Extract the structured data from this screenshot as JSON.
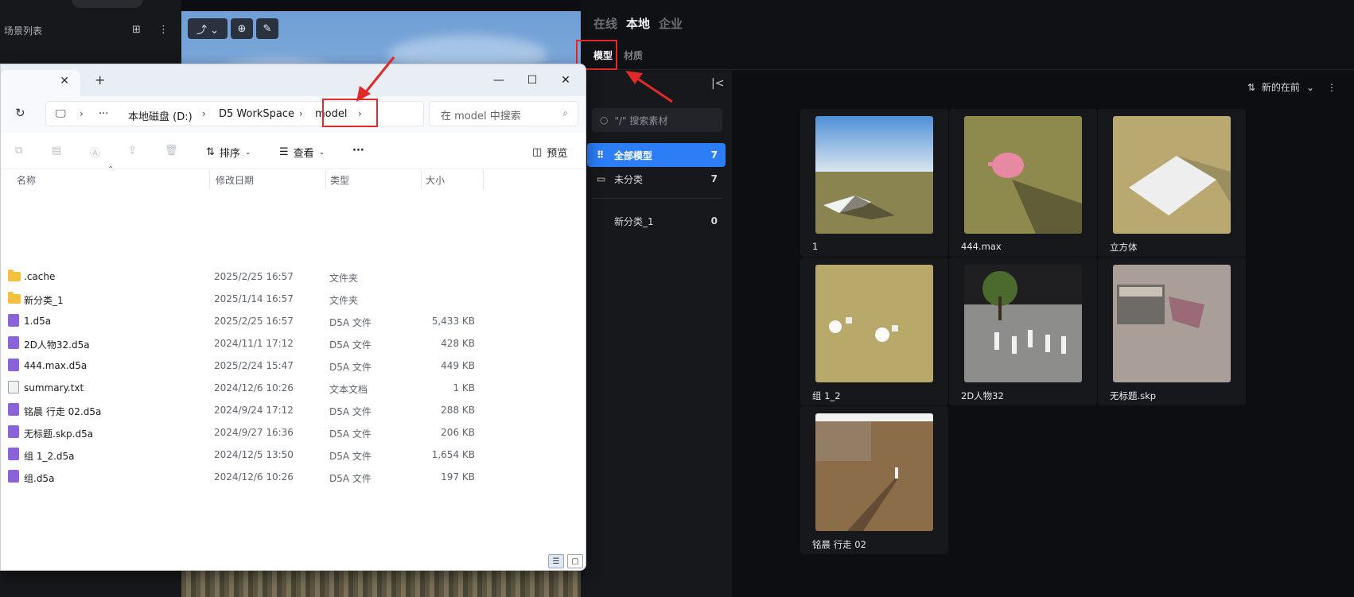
{
  "scene_panel": {
    "title": "场景列表"
  },
  "asset_panel": {
    "source_tabs": [
      "在线",
      "本地",
      "企业"
    ],
    "active_source": "本地",
    "sub_tabs": [
      "模型",
      "材质"
    ],
    "active_sub_tab": "模型",
    "search_placeholder": "\"/\" 搜索素材",
    "categories": [
      {
        "label": "全部模型",
        "count": "7",
        "active": true
      },
      {
        "label": "未分类",
        "count": "7",
        "active": false
      },
      {
        "label": "新分类_1",
        "count": "0",
        "active": false
      }
    ],
    "sort_label": "新的在前",
    "assets": [
      {
        "name": "1",
        "thumb": "sky-ground"
      },
      {
        "name": "444.max",
        "thumb": "teapot"
      },
      {
        "name": "立方体",
        "thumb": "cubes"
      },
      {
        "name": "组 1_2",
        "thumb": "spheres"
      },
      {
        "name": "2D人物32",
        "thumb": "people"
      },
      {
        "name": "无标题.skp",
        "thumb": "house"
      },
      {
        "name": "铭晨 行走 02",
        "thumb": "field"
      }
    ]
  },
  "explorer": {
    "breadcrumbs": [
      "本地磁盘 (D:)",
      "D5 WorkSpace",
      "model"
    ],
    "search_placeholder": "在 model 中搜索",
    "toolbar": {
      "sort": "排序",
      "view": "查看",
      "more": "···",
      "preview": "预览"
    },
    "columns": [
      "名称",
      "修改日期",
      "类型",
      "大小"
    ],
    "files": [
      {
        "name": ".cache",
        "date": "2025/2/25 16:57",
        "type": "文件夹",
        "size": "",
        "icon": "folder"
      },
      {
        "name": "新分类_1",
        "date": "2025/1/14 16:57",
        "type": "文件夹",
        "size": "",
        "icon": "folder"
      },
      {
        "name": "1.d5a",
        "date": "2025/2/25 16:57",
        "type": "D5A 文件",
        "size": "5,433 KB",
        "icon": "d5a"
      },
      {
        "name": "2D人物32.d5a",
        "date": "2024/11/1 17:12",
        "type": "D5A 文件",
        "size": "428 KB",
        "icon": "d5a"
      },
      {
        "name": "444.max.d5a",
        "date": "2025/2/24 15:47",
        "type": "D5A 文件",
        "size": "449 KB",
        "icon": "d5a"
      },
      {
        "name": "summary.txt",
        "date": "2024/12/6 10:26",
        "type": "文本文档",
        "size": "1 KB",
        "icon": "txt"
      },
      {
        "name": "铭晨 行走 02.d5a",
        "date": "2024/9/24 17:12",
        "type": "D5A 文件",
        "size": "288 KB",
        "icon": "d5a"
      },
      {
        "name": "无标题.skp.d5a",
        "date": "2024/9/27 16:36",
        "type": "D5A 文件",
        "size": "206 KB",
        "icon": "d5a"
      },
      {
        "name": "组 1_2.d5a",
        "date": "2024/12/5 13:50",
        "type": "D5A 文件",
        "size": "1,654 KB",
        "icon": "d5a"
      },
      {
        "name": "组.d5a",
        "date": "2024/12/6 10:26",
        "type": "D5A 文件",
        "size": "197 KB",
        "icon": "d5a"
      }
    ]
  },
  "colors": {
    "accent": "#2d7df6",
    "annotation": "#e02a2a"
  }
}
